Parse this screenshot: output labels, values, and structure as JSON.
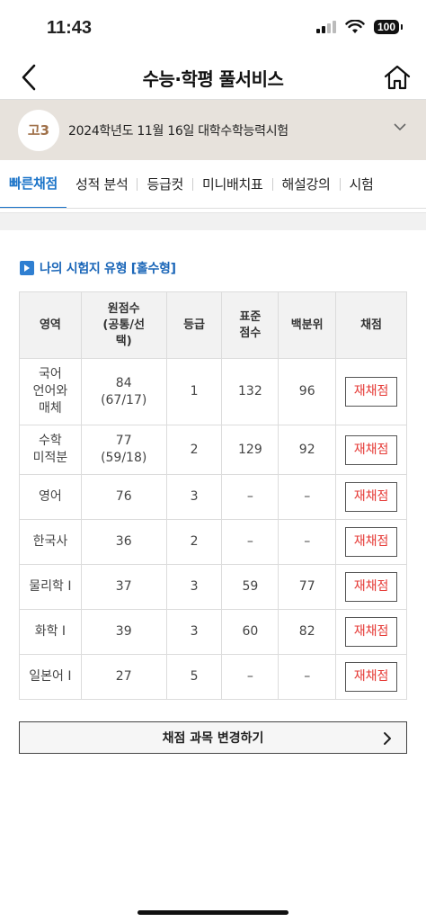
{
  "status": {
    "time": "11:43",
    "battery": "100"
  },
  "nav": {
    "title": "수능·학평 풀서비스"
  },
  "exam": {
    "grade": "고3",
    "name": "2024학년도 11월 16일 대학수학능력시험"
  },
  "tabs": [
    {
      "label": "빠른채점",
      "active": true
    },
    {
      "label": "성적 분석"
    },
    {
      "label": "등급컷"
    },
    {
      "label": "미니배치표"
    },
    {
      "label": "해설강의"
    },
    {
      "label": "시험"
    }
  ],
  "section": {
    "title": "나의 시험지 유형 [홀수형]"
  },
  "table": {
    "headers": [
      "영역",
      "원점수\n(공통/선\n택)",
      "등급",
      "표준\n점수",
      "백분위",
      "채점"
    ],
    "rows": [
      {
        "subject": "국어\n언어와\n매체",
        "raw": "84\n(67/17)",
        "grade": "1",
        "std": "132",
        "pct": "96",
        "action": "재채점"
      },
      {
        "subject": "수학\n미적분",
        "raw": "77\n(59/18)",
        "grade": "2",
        "std": "129",
        "pct": "92",
        "action": "재채점"
      },
      {
        "subject": "영어",
        "raw": "76",
        "grade": "3",
        "std": "–",
        "pct": "–",
        "action": "재채점"
      },
      {
        "subject": "한국사",
        "raw": "36",
        "grade": "2",
        "std": "–",
        "pct": "–",
        "action": "재채점"
      },
      {
        "subject": "물리학 I",
        "raw": "37",
        "grade": "3",
        "std": "59",
        "pct": "77",
        "action": "재채점"
      },
      {
        "subject": "화학 I",
        "raw": "39",
        "grade": "3",
        "std": "60",
        "pct": "82",
        "action": "재채점"
      },
      {
        "subject": "일본어 I",
        "raw": "27",
        "grade": "5",
        "std": "–",
        "pct": "–",
        "action": "재채점"
      }
    ]
  },
  "change_button": {
    "label": "채점 과목 변경하기"
  },
  "colors": {
    "accent": "#1a73c8",
    "rescore": "#e53935",
    "banner": "#e7e2dc"
  }
}
